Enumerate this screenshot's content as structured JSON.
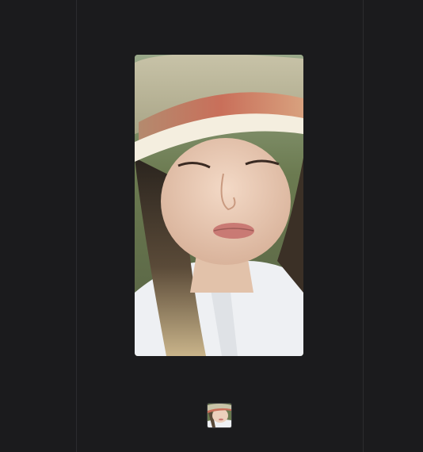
{
  "viewer": {
    "colors": {
      "background": "#1b1b1d",
      "divider": "#2c2c2f"
    }
  },
  "photo": {
    "subject": "portrait-selfie",
    "description_icon": "photo-image"
  },
  "thumbnail_strip": {
    "count": 1,
    "selected_index": 0
  }
}
